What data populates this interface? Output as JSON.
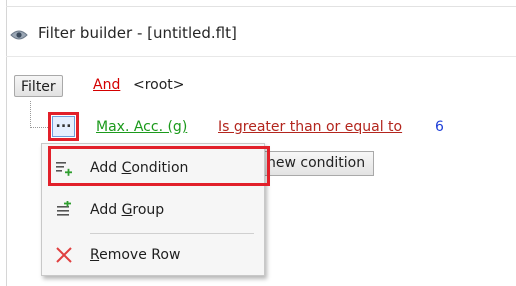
{
  "window": {
    "title": "Filter builder - [untitled.flt]",
    "title_icon": "eye-icon"
  },
  "filter": {
    "root_button": "Filter",
    "group_operator": "And",
    "root_label": "<root>"
  },
  "condition": {
    "row_menu_button": "...",
    "field": "Max. Acc. (g)",
    "operator": "Is greater than or equal to",
    "value": "6"
  },
  "new_condition_button": "new condition",
  "context_menu": {
    "items": [
      {
        "prefix": "Add ",
        "accel": "C",
        "suffix": "ondition",
        "icon": "add-condition-icon"
      },
      {
        "prefix": "Add ",
        "accel": "G",
        "suffix": "roup",
        "icon": "add-group-icon"
      },
      {
        "prefix": "",
        "accel": "R",
        "suffix": "emove Row",
        "icon": "remove-x-icon"
      }
    ]
  },
  "colors": {
    "highlight": "#e2202a",
    "and_link": "#d40000",
    "field_link": "#1c9a1c",
    "operator_link": "#b3261e",
    "value": "#1f3fd8"
  }
}
